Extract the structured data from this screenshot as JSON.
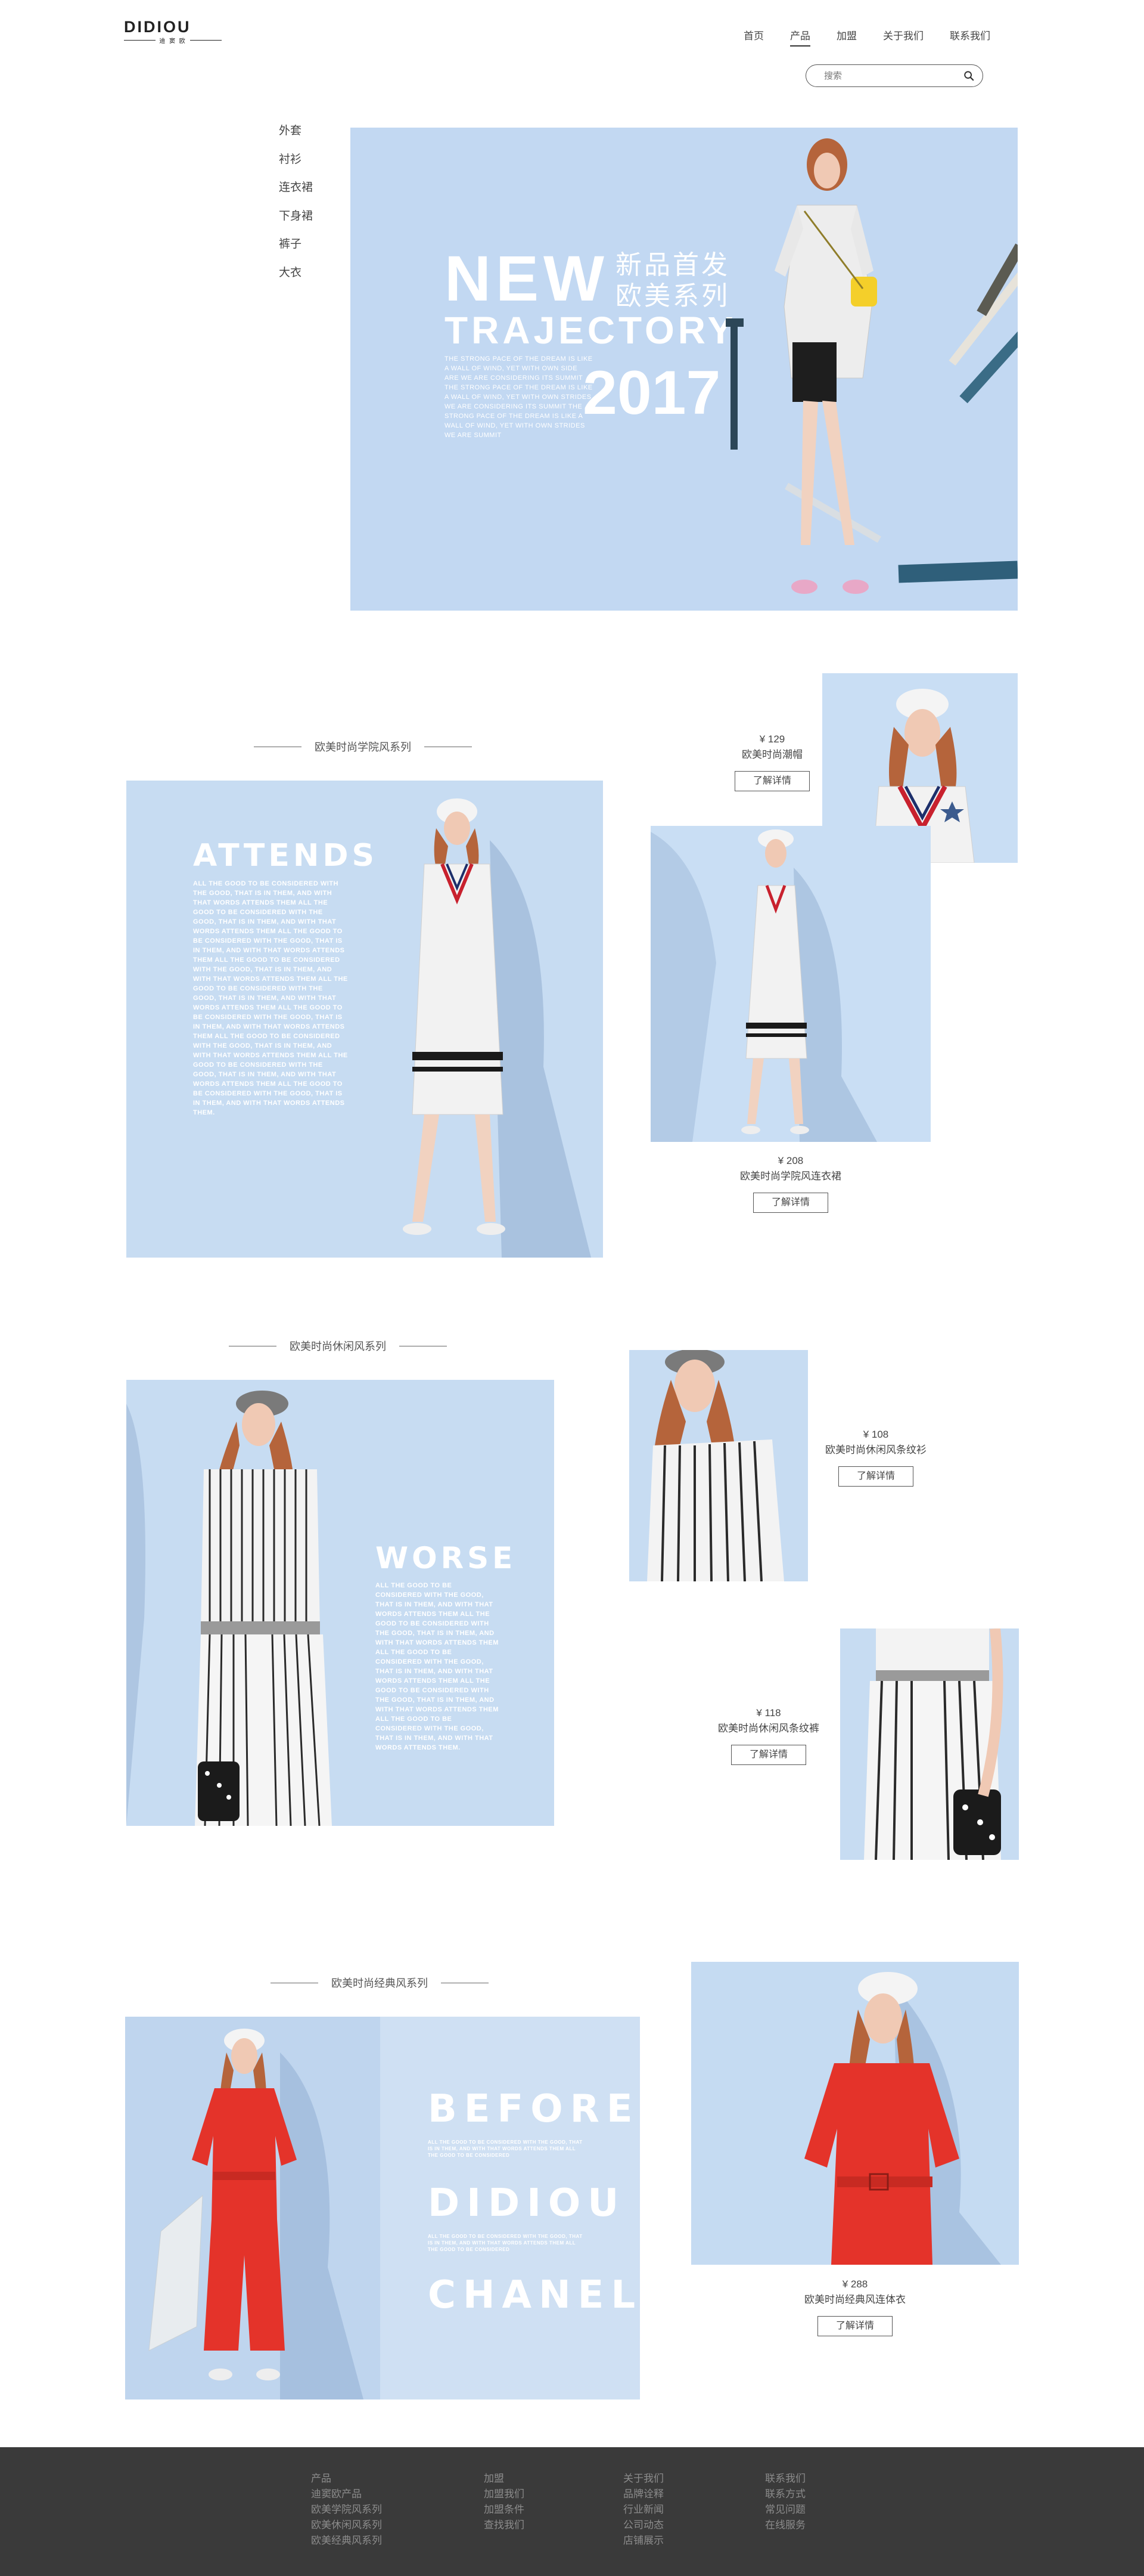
{
  "brand": {
    "name": "DIDIOU",
    "sub": "迪 窦 欧"
  },
  "nav": {
    "items": [
      "首页",
      "产品",
      "加盟",
      "关于我们",
      "联系我们"
    ],
    "active": 1
  },
  "search": {
    "placeholder": "搜索"
  },
  "side_menu": [
    "外套",
    "衬衫",
    "连衣裙",
    "下身裙",
    "裤子",
    "大衣"
  ],
  "hero": {
    "headline": "NEW",
    "headline2": "TRAJECTORY",
    "cn_line1": "新品首发",
    "cn_line2": "欧美系列",
    "year": "2017",
    "body": "THE STRONG PACE OF THE DREAM IS LIKE A WALL OF WIND, YET WITH OWN SIDE ARE WE ARE CONSIDERING ITS SUMMIT THE STRONG PACE OF THE DREAM IS LIKE A WALL OF WIND, YET WITH OWN STRIDES WE ARE CONSIDERING ITS SUMMIT THE STRONG PACE OF THE DREAM IS LIKE A WALL OF WIND, YET WITH OWN STRIDES WE ARE SUMMIT"
  },
  "sections": [
    {
      "title": "欧美时尚学院风系列",
      "big_word": "ATTENDS",
      "copy": "ALL THE GOOD TO BE CONSIDERED WITH THE GOOD, THAT IS IN THEM, AND WITH THAT WORDS ATTENDS THEM ALL THE GOOD TO BE CONSIDERED WITH THE GOOD, THAT IS IN THEM, AND WITH THAT WORDS ATTENDS THEM ALL THE GOOD TO BE CONSIDERED WITH THE GOOD, THAT IS IN THEM, AND WITH THAT WORDS ATTENDS THEM ALL THE GOOD TO BE CONSIDERED WITH THE GOOD, THAT IS IN THEM, AND WITH THAT WORDS ATTENDS THEM ALL THE GOOD TO BE CONSIDERED WITH THE GOOD, THAT IS IN THEM, AND WITH THAT WORDS ATTENDS THEM ALL THE GOOD TO BE CONSIDERED WITH THE GOOD, THAT IS IN THEM, AND WITH THAT WORDS ATTENDS THEM ALL THE GOOD TO BE CONSIDERED WITH THE GOOD, THAT IS IN THEM, AND WITH THAT WORDS ATTENDS THEM ALL THE GOOD TO BE CONSIDERED WITH THE GOOD, THAT IS IN THEM, AND WITH THAT WORDS ATTENDS THEM ALL THE GOOD TO BE CONSIDERED WITH THE GOOD, THAT IS IN THEM, AND WITH THAT WORDS ATTENDS THEM.",
      "products": [
        {
          "price": "¥ 129",
          "name": "欧美时尚潮帽",
          "button": "了解详情"
        },
        {
          "price": "¥ 208",
          "name": "欧美时尚学院风连衣裙",
          "button": "了解详情"
        }
      ]
    },
    {
      "title": "欧美时尚休闲风系列",
      "big_word": "WORSE",
      "copy": "ALL THE GOOD TO BE CONSIDERED WITH THE GOOD, THAT IS IN THEM, AND WITH THAT WORDS ATTENDS THEM ALL THE GOOD TO BE CONSIDERED WITH THE GOOD, THAT IS IN THEM, AND WITH THAT WORDS ATTENDS THEM ALL THE GOOD TO BE CONSIDERED WITH THE GOOD, THAT IS IN THEM, AND WITH THAT WORDS ATTENDS THEM ALL THE GOOD TO BE CONSIDERED WITH THE GOOD, THAT IS IN THEM, AND WITH THAT WORDS ATTENDS THEM ALL THE GOOD TO BE CONSIDERED WITH THE GOOD, THAT IS IN THEM, AND WITH THAT WORDS ATTENDS THEM.",
      "products": [
        {
          "price": "¥ 108",
          "name": "欧美时尚休闲风条纹衫",
          "button": "了解详情"
        },
        {
          "price": "¥ 118",
          "name": "欧美时尚休闲风条纹裤",
          "button": "了解详情"
        }
      ]
    },
    {
      "title": "欧美时尚经典风系列",
      "words": [
        "BEFORE",
        "DIDIOU",
        "CHANEL"
      ],
      "copy1": "ALL THE GOOD TO BE CONSIDERED WITH THE GOOD, THAT IS IN THEM, AND WITH THAT WORDS ATTENDS THEM ALL THE GOOD TO BE CONSIDERED",
      "copy2": "ALL THE GOOD TO BE CONSIDERED WITH THE GOOD, THAT IS IN THEM, AND WITH THAT WORDS ATTENDS THEM ALL THE GOOD TO BE CONSIDERED",
      "products": [
        {
          "price": "¥ 288",
          "name": "欧美时尚经典风连体衣",
          "button": "了解详情"
        }
      ]
    }
  ],
  "footer": {
    "columns": [
      [
        "产品",
        "迪窦欧产品",
        "欧美学院风系列",
        "欧美休闲风系列",
        "欧美经典风系列"
      ],
      [
        "加盟",
        "加盟我们",
        "加盟条件",
        "查找我们"
      ],
      [
        "关于我们",
        "品牌诠释",
        "行业新闻",
        "公司动态",
        "店铺展示"
      ],
      [
        "联系我们",
        "联系方式",
        "常见问题",
        "在线服务"
      ]
    ]
  },
  "colors": {
    "panel_blue": "#c7dcf2",
    "hero_blue": "#c2d8f2",
    "footer_bg": "#3a3a3a",
    "red_dress": "#e4332a"
  }
}
